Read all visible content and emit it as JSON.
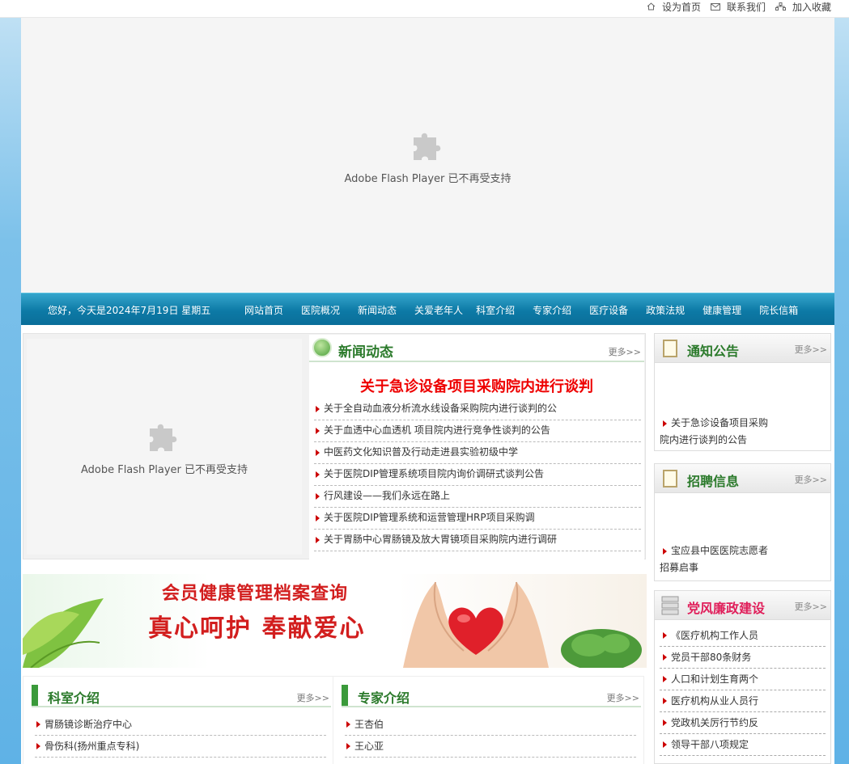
{
  "topbar": {
    "links": [
      {
        "label": "设为首页",
        "icon": "home-icon"
      },
      {
        "label": "联系我们",
        "icon": "mail-icon"
      },
      {
        "label": "加入收藏",
        "icon": "sitemap-icon"
      }
    ]
  },
  "flash_banner": {
    "message": "Adobe Flash Player 已不再受支持",
    "icon": "puzzle-plugin-icon"
  },
  "nav": {
    "greeting": "您好，今天是2024年7月19日 星期五",
    "items": [
      "网站首页",
      "医院概况",
      "新闻动态",
      "关爱老年人",
      "科室介绍",
      "专家介绍",
      "医疗设备",
      "政策法规",
      "健康管理",
      "院长信箱"
    ]
  },
  "flash_small": {
    "message": "Adobe Flash Player 已不再受支持"
  },
  "news": {
    "title": "新闻动态",
    "more": "更多>>",
    "headline": "关于急诊设备项目采购院内进行谈判",
    "items": [
      "关于全自动血液分析流水线设备采购院内进行谈判的公",
      "关于血透中心血透机 项目院内进行竞争性谈判的公告",
      "中医药文化知识普及行动走进县实验初级中学",
      "关于医院DIP管理系统项目院内询价调研式谈判公告",
      "行风建设——我们永远在路上",
      "关于医院DIP管理系统和运营管理HRP项目采购调",
      "关于胃肠中心胃肠镜及放大胃镜项目采购院内进行调研"
    ]
  },
  "promo": {
    "line1": "会员健康管理档案查询",
    "line2": "真心呵护  奉献爱心"
  },
  "departments": {
    "title": "科室介绍",
    "more": "更多>>",
    "items": [
      "胃肠镜诊断治疗中心",
      "骨伤科(扬州重点专科)"
    ]
  },
  "experts": {
    "title": "专家介绍",
    "more": "更多>>",
    "items": [
      "王杏伯",
      "王心亚"
    ]
  },
  "notice": {
    "title": "通知公告",
    "more": "更多>>",
    "line1": "关于急诊设备项目采购",
    "line2": "院内进行谈判的公告"
  },
  "recruit": {
    "title": "招聘信息",
    "more": "更多>>",
    "line1": "宝应县中医医院志愿者",
    "line2": "招募启事"
  },
  "integrity": {
    "title": "党风廉政建设",
    "more": "更多>>",
    "items": [
      "《医疗机构工作人员",
      "党员干部80条财务",
      "人口和计划生育两个",
      "医疗机构从业人员行",
      "党政机关厉行节约反",
      "领导干部八项规定"
    ]
  },
  "colors": {
    "nav_bg": "#0d7aa6",
    "accent_green": "#2b7a2b",
    "headline_red": "#e00000",
    "side_bg": "#7cc1ea"
  }
}
